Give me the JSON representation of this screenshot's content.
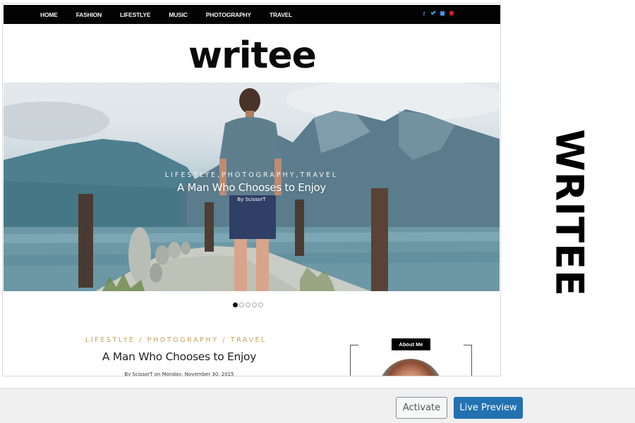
{
  "theme_preview": {
    "nav": {
      "items": [
        "HOME",
        "FASHION",
        "LIFESTLYE",
        "MUSIC",
        "PHOTOGRAPHY",
        "TRAVEL"
      ],
      "social_icons": [
        {
          "name": "facebook-icon",
          "glyph": "f",
          "color": "#4a65a8"
        },
        {
          "name": "twitter-icon",
          "glyph": "t",
          "color": "#2aa3e6"
        },
        {
          "name": "instagram-icon",
          "glyph": "◙",
          "color": "#2f6cb8"
        },
        {
          "name": "pinterest-icon",
          "glyph": "p",
          "color": "#d0202a"
        }
      ]
    },
    "logo": "writee",
    "hero": {
      "categories": "LIFESTLYE,PHOTOGRAPHY,TRAVEL",
      "title": "A Man Who Chooses to Enjoy",
      "byline": "By ScissorT"
    },
    "slider": {
      "total": 5,
      "active": 1
    },
    "post": {
      "categories": "LIFESTLYE  / PHOTOGRAPHY  / TRAVEL",
      "title": "A Man Who Chooses to Enjoy",
      "meta": "By ScissorT on Monday, November 30, 2015"
    },
    "sidebar": {
      "about_label": "About Me"
    }
  },
  "theme_name": "WRITEE",
  "actions": {
    "activate_label": "Activate",
    "live_preview_label": "Live Preview",
    "primary_color": "#2271b1"
  }
}
